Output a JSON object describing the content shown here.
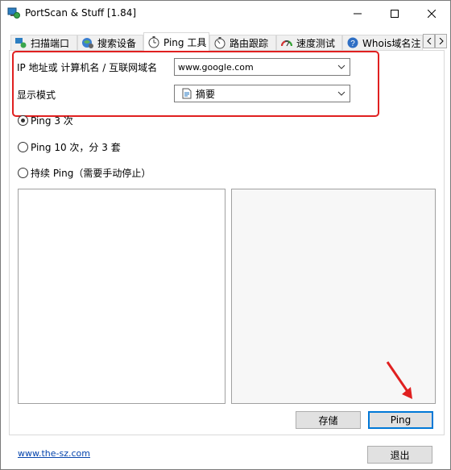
{
  "window": {
    "title": "PortScan & Stuff [1.84]"
  },
  "tabs": [
    {
      "label": "扫描端口",
      "icon": "network-icon"
    },
    {
      "label": "搜索设备",
      "icon": "globe-icon"
    },
    {
      "label": "Ping 工具",
      "icon": "stopwatch-icon",
      "active": true
    },
    {
      "label": "路由跟踪",
      "icon": "route-icon"
    },
    {
      "label": "速度测试",
      "icon": "speedometer-icon"
    },
    {
      "label": "Whois域名注",
      "icon": "whois-icon"
    }
  ],
  "form": {
    "host_label": "IP 地址或 计算机名 / 互联网域名",
    "host_value": "www.google.com",
    "mode_label": "显示模式",
    "mode_value": "摘要"
  },
  "options": [
    {
      "label": "Ping 3 次",
      "selected": true
    },
    {
      "label": "Ping 10 次，分 3 套",
      "selected": false
    },
    {
      "label": "持续 Ping（需要手动停止）",
      "selected": false
    }
  ],
  "buttons": {
    "save": "存储",
    "ping": "Ping",
    "exit": "退出"
  },
  "footer": {
    "link": "www.the-sz.com"
  },
  "colors": {
    "highlight": "#e02020",
    "accent": "#0078d7"
  }
}
